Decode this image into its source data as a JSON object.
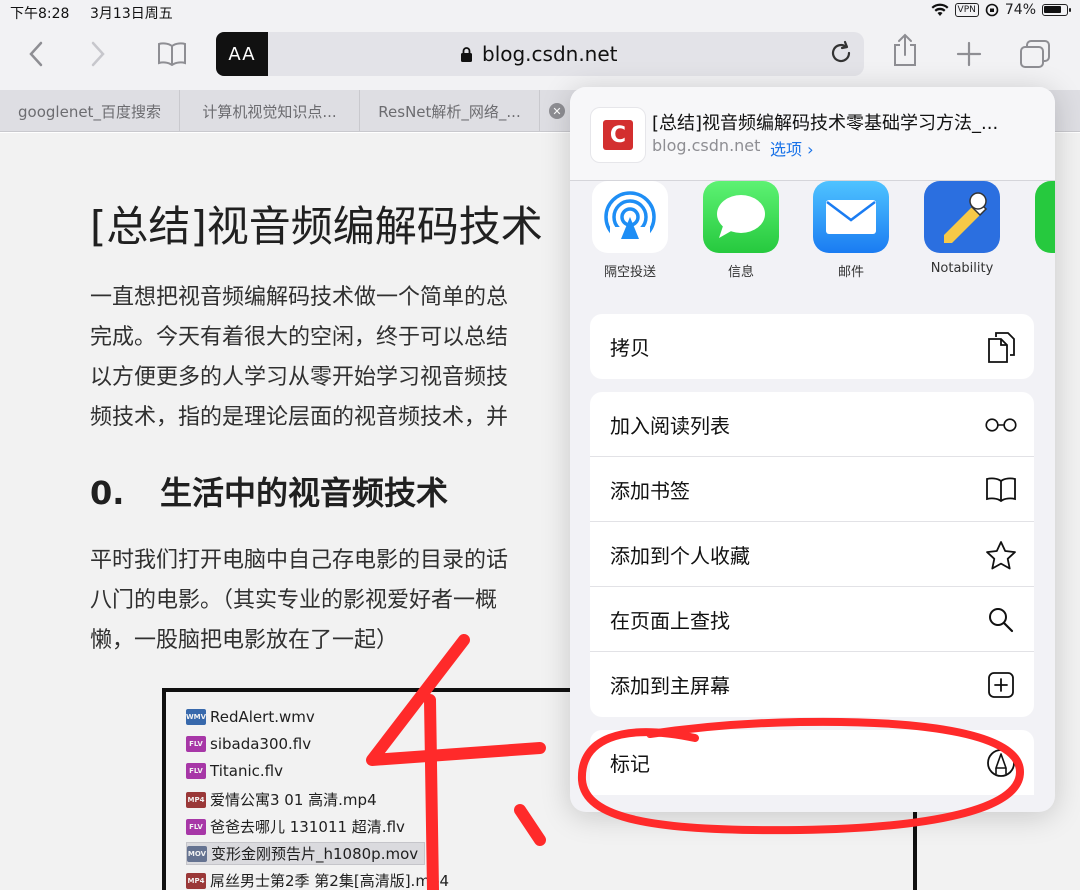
{
  "status": {
    "time": "下午8:28",
    "date": "3月13日周五",
    "vpn": "VPN",
    "battery": "74%"
  },
  "toolbar": {
    "reader_label": "AA",
    "url": "blog.csdn.net"
  },
  "tabs": [
    {
      "label": "googlenet_百度搜索"
    },
    {
      "label": "计算机视觉知识点..."
    },
    {
      "label": "ResNet解析_网络_..."
    }
  ],
  "article": {
    "title": "[总结]视音频编解码技术",
    "lines": [
      "一直想把视音频编解码技术做一个简单的总",
      "完成。今天有着很大的空闲，终于可以总结",
      "以方便更多的人学习从零开始学习视音频技",
      "频技术，指的是理论层面的视音频技术，并"
    ],
    "section_num": "0.",
    "section_title": "生活中的视音频技术",
    "lines2": [
      "平时我们打开电脑中自己存电影的目录的话",
      "八门的电影。（其实专业的影视爱好者一概",
      "懒，一股脑把电影放在了一起）"
    ],
    "files": [
      {
        "name": "RedAlert.wmv",
        "tag": "WMV"
      },
      {
        "name": "sibada300.flv",
        "tag": "FLV"
      },
      {
        "name": "Titanic.flv",
        "tag": "FLV"
      },
      {
        "name": "爱情公寓3 01 高清.mp4",
        "tag": "MP4"
      },
      {
        "name": "爸爸去哪儿 131011 超清.flv",
        "tag": "FLV"
      },
      {
        "name": "变形金刚预告片_h1080p.mov",
        "tag": "MOV"
      },
      {
        "name": "屌丝男士第2季 第2集[高清版].mp4",
        "tag": "MP4"
      }
    ]
  },
  "share": {
    "title": "[总结]视音频编解码技术零基础学习方法_...",
    "domain": "blog.csdn.net",
    "options": "选项 ›",
    "apps": [
      {
        "label": "隔空投送"
      },
      {
        "label": "信息"
      },
      {
        "label": "邮件"
      },
      {
        "label": "Notability"
      }
    ],
    "copy": "拷贝",
    "actions": [
      {
        "label": "加入阅读列表"
      },
      {
        "label": "添加书签"
      },
      {
        "label": "添加到个人收藏"
      },
      {
        "label": "在页面上查找"
      },
      {
        "label": "添加到主屏幕"
      }
    ],
    "markup": "标记"
  },
  "colors": {
    "accent": "#1a73e8",
    "annotation": "#ff2a2a",
    "csdn": "#d32f2f"
  },
  "annotation_text": "4."
}
